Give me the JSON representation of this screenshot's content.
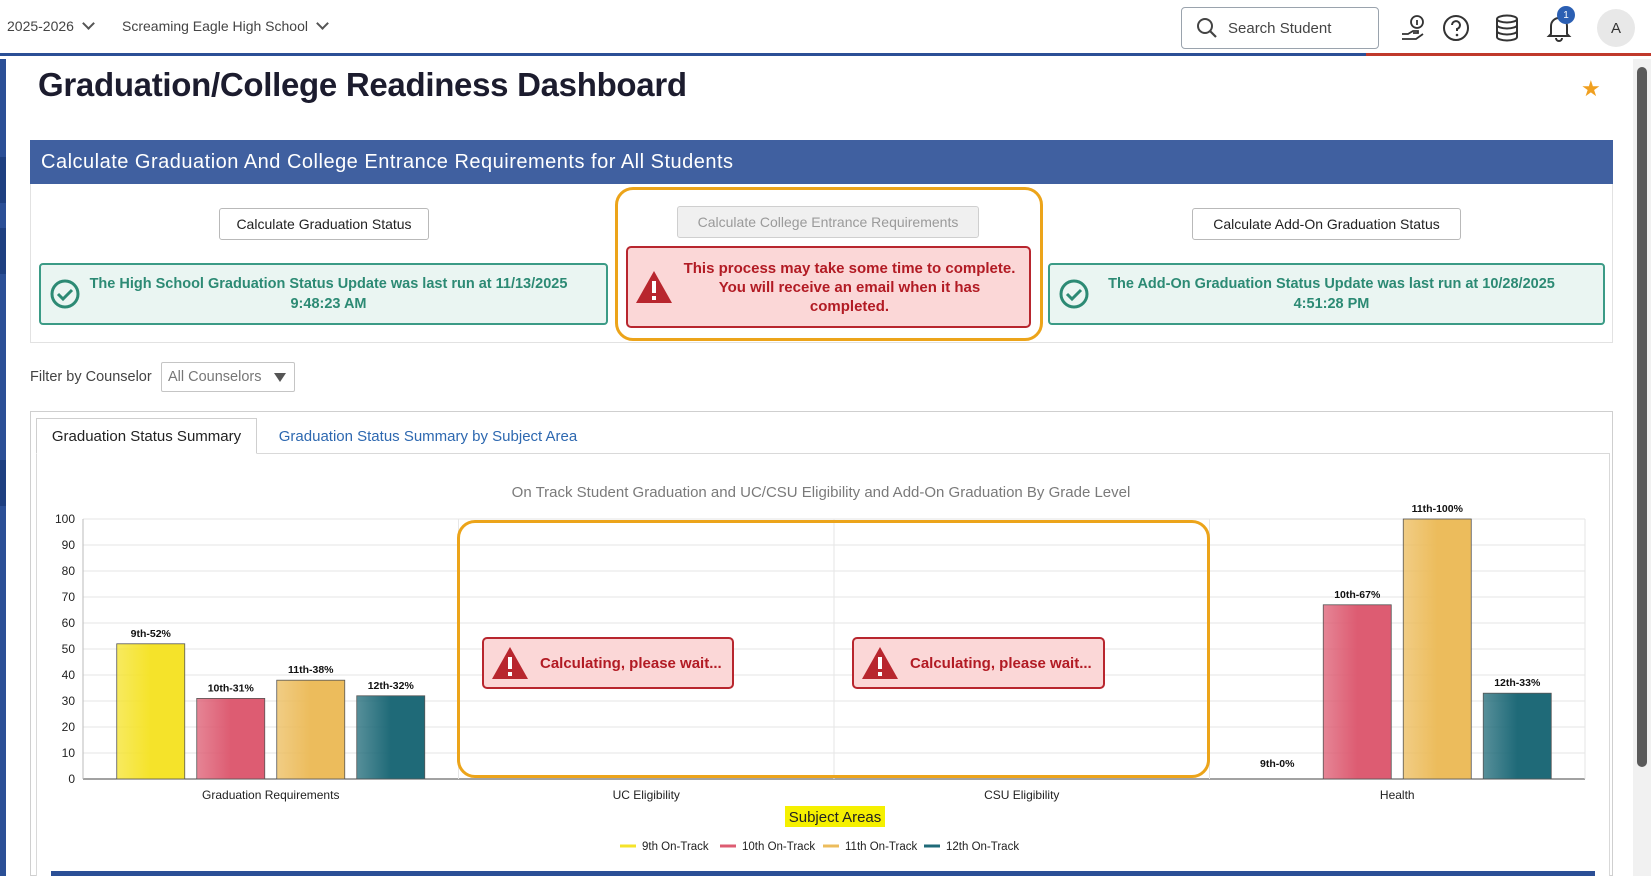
{
  "header": {
    "year_selector": "2025-2026",
    "school_selector": "Screaming Eagle High School",
    "search_placeholder": "Search Student",
    "notification_count": "1",
    "avatar_initial": "A"
  },
  "page": {
    "title": "Graduation/College Readiness Dashboard"
  },
  "calc_section": {
    "title": "Calculate Graduation And College Entrance Requirements for All Students",
    "grad_button": "Calculate Graduation Status",
    "college_button": "Calculate College Entrance Requirements",
    "addon_button": "Calculate Add-On Graduation Status",
    "grad_status_line1": "The High School Graduation Status Update was last run at 11/13/2025",
    "grad_status_line2": "9:48:23 AM",
    "college_warning_line1": "This process may take some time to complete.",
    "college_warning_line2": "You will receive an email when it has",
    "college_warning_line3": "completed.",
    "addon_status_line1": "The Add-On Graduation Status Update was last run at 10/28/2025",
    "addon_status_line2": "4:51:28 PM"
  },
  "filter": {
    "label": "Filter by Counselor",
    "value": "All Counselors"
  },
  "tabs": [
    {
      "label": "Graduation Status Summary",
      "active": true
    },
    {
      "label": "Graduation Status Summary by Subject Area",
      "active": false
    }
  ],
  "calculating_message": "Calculating, please wait...",
  "colors": {
    "9th": "#f5e32a",
    "10th": "#dd5c72",
    "11th": "#ecbc5c",
    "12th": "#1f6a78"
  },
  "chart_data": {
    "type": "bar",
    "title": "On Track Student Graduation and UC/CSU Eligibility and Add-On Graduation By Grade Level",
    "xlabel": "Subject Areas",
    "ylim": [
      0,
      100
    ],
    "yticks": [
      0,
      10,
      20,
      30,
      40,
      50,
      60,
      70,
      80,
      90,
      100
    ],
    "categories": [
      "Graduation Requirements",
      "UC Eligibility",
      "CSU Eligibility",
      "Health"
    ],
    "legend_position": "bottom",
    "series": [
      {
        "name": "9th On-Track",
        "values": [
          52,
          null,
          null,
          0
        ],
        "labels": [
          "9th-52%",
          "",
          "",
          "9th-0%"
        ]
      },
      {
        "name": "10th On-Track",
        "values": [
          31,
          null,
          null,
          67
        ],
        "labels": [
          "10th-31%",
          "",
          "",
          "10th-67%"
        ]
      },
      {
        "name": "11th On-Track",
        "values": [
          38,
          null,
          null,
          100
        ],
        "labels": [
          "11th-38%",
          "",
          "",
          "11th-100%"
        ]
      },
      {
        "name": "12th On-Track",
        "values": [
          32,
          null,
          null,
          33
        ],
        "labels": [
          "12th-32%",
          "",
          "",
          "12th-33%"
        ]
      }
    ]
  }
}
